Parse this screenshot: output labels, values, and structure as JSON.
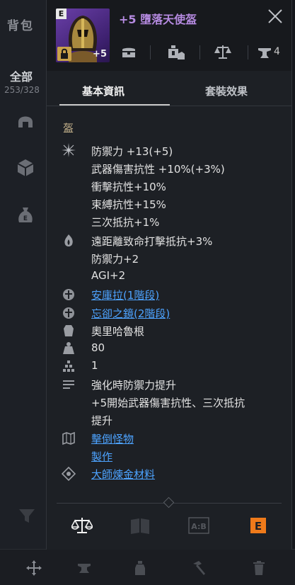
{
  "sidebar": {
    "bag_title": "背包",
    "all_label": "全部",
    "bag_count": "253/328",
    "icons": [
      "helmet-icon",
      "box-icon",
      "money-bag-icon"
    ]
  },
  "item": {
    "name": "+5 墮落天使盔",
    "rank": "E",
    "upgrade_badge": "+5",
    "quantity": "4",
    "name_color": "#b58ae0"
  },
  "tabs": {
    "basic": "基本資訊",
    "set": "套裝效果"
  },
  "detail": {
    "category": "盔",
    "base_stats": [
      "防禦力 +13(+5)",
      "武器傷害抗性 +10%(+3%)",
      "衝擊抗性+10%",
      "束縛抗性+15%",
      "三次抵抗+1%"
    ],
    "bonus_stats": [
      "遠距離致命打擊抵抗+3%",
      "防禦力+2",
      "AGI+2"
    ],
    "runes": [
      "安庫拉(1階段)",
      "忘卻之鏡(2階段)"
    ],
    "maker": "奧里哈魯根",
    "weight": "80",
    "stack": "1",
    "effect_lines": [
      "強化時防禦力提升",
      "+5開始武器傷害抗性、三次抵抗",
      "提升"
    ],
    "sources": [
      "擊倒怪物",
      "製作",
      "大師煉金材料"
    ]
  },
  "footer": {
    "rank_label": "E"
  },
  "colors": {
    "link": "#4da3ff",
    "accent_orange": "#ef7a1a",
    "purple": "#b58ae0"
  }
}
